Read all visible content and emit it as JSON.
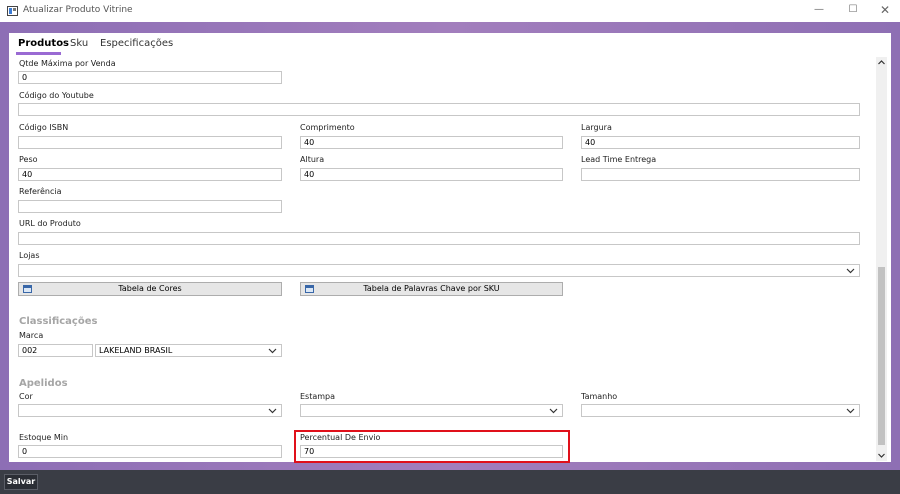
{
  "window": {
    "title": "Atualizar Produto Vitrine",
    "min_glyph": "—",
    "max_glyph": "☐",
    "close_glyph": "✕"
  },
  "tabs": [
    {
      "label": "Produtos",
      "active": true
    },
    {
      "label": "Sku",
      "active": false
    },
    {
      "label": "Especificações",
      "active": false
    }
  ],
  "fields": {
    "qtde_maxima": {
      "label": "Qtde Máxima por Venda",
      "value": "0"
    },
    "codigo_youtube": {
      "label": "Código do Youtube",
      "value": ""
    },
    "codigo_isbn": {
      "label": "Código ISBN",
      "value": ""
    },
    "comprimento": {
      "label": "Comprimento",
      "value": "40"
    },
    "largura": {
      "label": "Largura",
      "value": "40"
    },
    "peso": {
      "label": "Peso",
      "value": "40"
    },
    "altura": {
      "label": "Altura",
      "value": "40"
    },
    "lead_time": {
      "label": "Lead Time Entrega",
      "value": ""
    },
    "referencia": {
      "label": "Referência",
      "value": ""
    },
    "url_produto": {
      "label": "URL do Produto",
      "value": ""
    },
    "lojas": {
      "label": "Lojas",
      "value": ""
    }
  },
  "buttons": {
    "tabela_cores": "Tabela de Cores",
    "tabela_palavras": "Tabela de Palavras Chave por SKU",
    "salvar": "Salvar"
  },
  "classificacoes": {
    "title": "Classificações",
    "marca": {
      "label": "Marca",
      "code": "002",
      "name": "LAKELAND BRASIL"
    }
  },
  "apelidos": {
    "title": "Apelidos",
    "cor": {
      "label": "Cor",
      "value": ""
    },
    "estampa": {
      "label": "Estampa",
      "value": ""
    },
    "tamanho": {
      "label": "Tamanho",
      "value": ""
    }
  },
  "estoque_min": {
    "label": "Estoque Min",
    "value": "0"
  },
  "percentual_envio": {
    "label": "Percentual De Envio",
    "value": "70"
  },
  "colors": {
    "accent": "#9a6ad3",
    "highlight": "#e0101a",
    "frame": "#9a79bb",
    "bottom_bar": "#3a3d45"
  }
}
